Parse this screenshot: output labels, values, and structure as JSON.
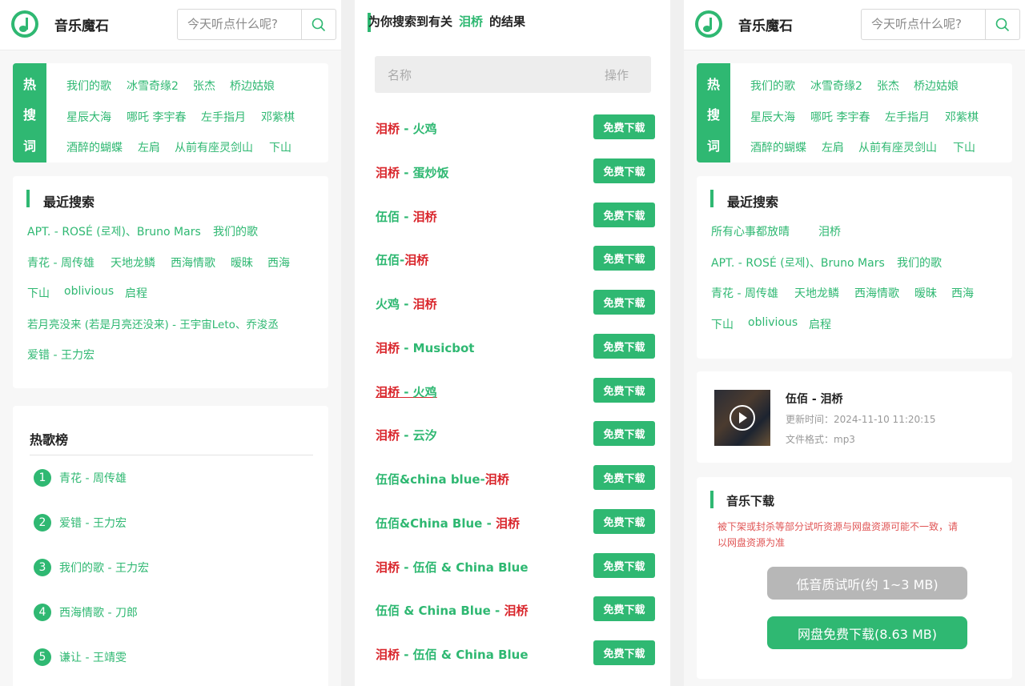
{
  "app": {
    "name": "音乐魔石"
  },
  "search": {
    "placeholder": "今天听点什么呢?"
  },
  "hot_search": {
    "label_chars": [
      "热",
      "搜",
      "词"
    ],
    "rows": [
      [
        "我们的歌",
        "冰雪奇缘2",
        "张杰",
        "桥边姑娘"
      ],
      [
        "星辰大海",
        "哪吒 李宇春",
        "左手指月",
        "邓紫棋"
      ],
      [
        "酒醉的蝴蝶",
        "左肩",
        "从前有座灵剑山",
        "下山"
      ]
    ]
  },
  "recent_left": {
    "title": "最近搜索",
    "rows": [
      [
        "APT. - ROSÉ (로제)、Bruno Mars",
        "我们的歌"
      ],
      [
        "青花 - 周传雄",
        "天地龙鳞",
        "西海情歌",
        "暧昧",
        "西海"
      ],
      [
        "下山",
        "oblivious",
        "启程"
      ],
      [
        "若月亮没来 (若是月亮还没来) - 王宇宙Leto、乔浚丞"
      ],
      [
        "爱错 - 王力宏"
      ]
    ]
  },
  "hot_chart": {
    "title": "热歌榜",
    "items": [
      {
        "num": "1",
        "label": "青花 - 周传雄"
      },
      {
        "num": "2",
        "label": "爱错 - 王力宏"
      },
      {
        "num": "3",
        "label": "我们的歌 - 王力宏"
      },
      {
        "num": "4",
        "label": "西海情歌 - 刀郎"
      },
      {
        "num": "5",
        "label": "谦让 - 王靖雯"
      }
    ]
  },
  "results": {
    "prefix": "为你搜索到有关",
    "keyword": "泪桥",
    "suffix": "的结果",
    "col_name": "名称",
    "col_action": "操作",
    "download_label": "免费下载",
    "rows": [
      [
        {
          "t": "泪桥",
          "c": "r"
        },
        {
          "t": " - 火鸡",
          "c": "g"
        }
      ],
      [
        {
          "t": "泪桥",
          "c": "r"
        },
        {
          "t": " - 蛋炒饭",
          "c": "g"
        }
      ],
      [
        {
          "t": "伍佰 - ",
          "c": "g"
        },
        {
          "t": "泪桥",
          "c": "r"
        }
      ],
      [
        {
          "t": "伍佰-",
          "c": "g"
        },
        {
          "t": "泪桥",
          "c": "r"
        }
      ],
      [
        {
          "t": "火鸡 - ",
          "c": "g"
        },
        {
          "t": "泪桥",
          "c": "r"
        }
      ],
      [
        {
          "t": "泪桥",
          "c": "r"
        },
        {
          "t": " - Musicbot",
          "c": "g"
        }
      ],
      [
        {
          "t": "泪桥",
          "c": "r"
        },
        {
          "t": " - 火鸡",
          "c": "g"
        }
      ],
      [
        {
          "t": "泪桥",
          "c": "r"
        },
        {
          "t": " - 云汐",
          "c": "g"
        }
      ],
      [
        {
          "t": "伍佰&china blue-",
          "c": "g"
        },
        {
          "t": "泪桥",
          "c": "r"
        }
      ],
      [
        {
          "t": "伍佰&China Blue - ",
          "c": "g"
        },
        {
          "t": "泪桥",
          "c": "r"
        }
      ],
      [
        {
          "t": "泪桥",
          "c": "r"
        },
        {
          "t": " - 伍佰 & China Blue",
          "c": "g"
        }
      ],
      [
        {
          "t": "伍佰 & China Blue - ",
          "c": "g"
        },
        {
          "t": "泪桥",
          "c": "r"
        }
      ],
      [
        {
          "t": "泪桥",
          "c": "r"
        },
        {
          "t": " - 伍佰 & China Blue",
          "c": "g"
        }
      ]
    ]
  },
  "recent_right": {
    "title": "最近搜索",
    "rows": [
      [
        "所有心事都放晴",
        "泪桥"
      ],
      [
        "APT. - ROSÉ (로제)、Bruno Mars",
        "我们的歌"
      ],
      [
        "青花 - 周传雄",
        "天地龙鳞",
        "西海情歌",
        "暧昧",
        "西海"
      ],
      [
        "下山",
        "oblivious",
        "启程"
      ]
    ]
  },
  "song": {
    "title": "伍佰 - 泪桥",
    "updated": "更新时间：2024-11-10 11:20:15",
    "format": "文件格式：mp3"
  },
  "download": {
    "title": "音乐下载",
    "notice_line1": "被下架或封杀等部分试听资源与网盘资源可能不一致，请",
    "notice_line2": "以网盘资源为准",
    "low_quality_label": "低音质试听(约 1~3 MB)",
    "pan_label": "网盘免费下载(8.63 MB)"
  },
  "colors": {
    "accent": "#2fb872",
    "highlight": "#d9262c",
    "notice": "#e05555"
  },
  "icons": {
    "logo": "music-note-icon",
    "search": "search-icon",
    "play": "play-icon"
  }
}
